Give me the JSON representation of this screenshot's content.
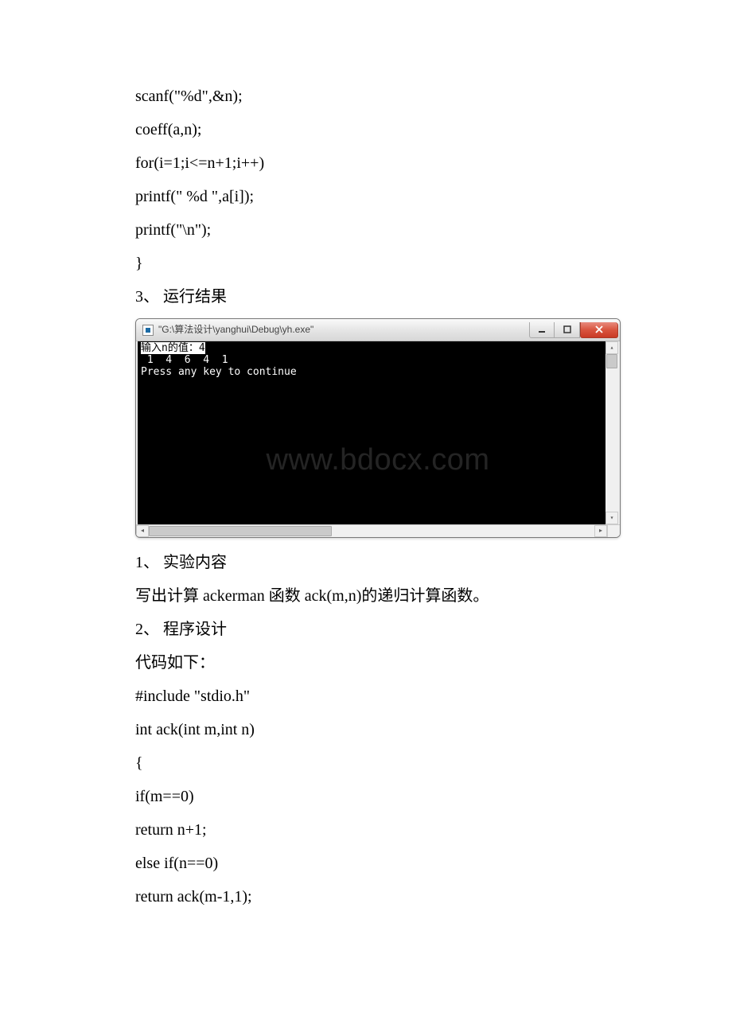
{
  "code_top": [
    " scanf(\"%d\",&n);",
    " coeff(a,n);",
    " for(i=1;i<=n+1;i++)",
    "  printf(\" %d \",a[i]);",
    " printf(\"\\n\");",
    "}"
  ],
  "section_run_result": "3、 运行结果",
  "console": {
    "title": "\"G:\\算法设计\\yanghui\\Debug\\yh.exe\"",
    "lines": [
      {
        "text": "输入n的值：4",
        "highlight": true
      },
      {
        "text": " 1  4  6  4  1",
        "highlight": false
      },
      {
        "text": "Press any key to continue",
        "highlight": false
      }
    ],
    "watermark": "www.bdocx.com"
  },
  "section_exp_content_label": "1、 实验内容",
  "exp_content_text": "写出计算 ackerman 函数 ack(m,n)的递归计算函数。",
  "section_prog_design_label": "2、 程序设计",
  "code_intro": "代码如下：",
  "code_bottom": [
    "#include \"stdio.h\"",
    "int ack(int m,int n)",
    "{",
    " if(m==0)",
    "  return n+1;",
    " else if(n==0)",
    "  return ack(m-1,1);"
  ]
}
